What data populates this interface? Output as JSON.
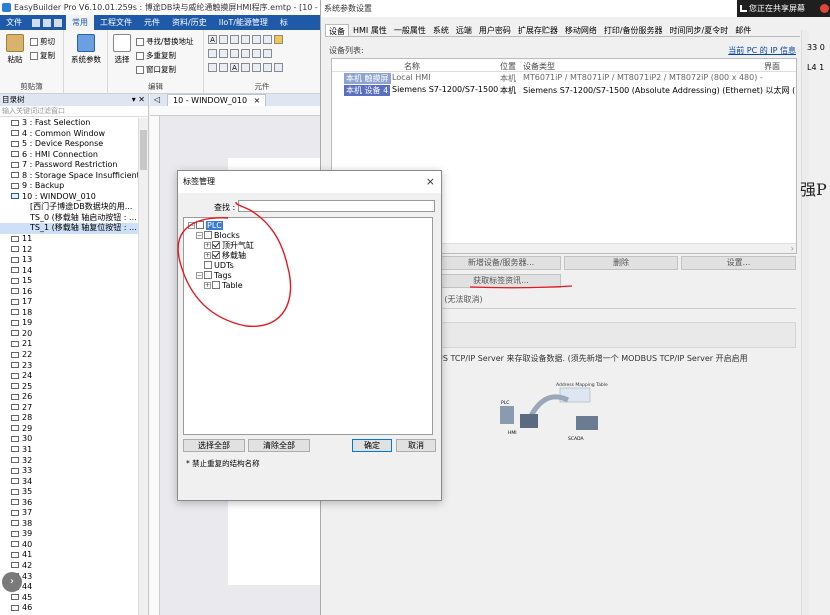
{
  "app": {
    "title": "EasyBuilder Pro V6.10.01.259s : 博途DB块与威纶通触摸屏HMI程序.emtp - [10 - WINDOW_010]",
    "menu": [
      "文件",
      "常用",
      "工程文件",
      "元件",
      "资料/历史",
      "IIoT/能源管理",
      "标"
    ],
    "active_menu": "常用",
    "ribbon": {
      "paste": "粘贴",
      "cut": "剪切",
      "copy": "复制",
      "clipboard_group": "剪贴簿",
      "sys_params": "系统参数",
      "select": "选择",
      "find_replace": "寻找/替换地址",
      "multi_copy": "多重复制",
      "window_copy": "窗口复制",
      "edit_group": "编辑",
      "element_group": "元件"
    },
    "tree": {
      "header": "目录树",
      "filter_placeholder": "输入关键词过滤窗口",
      "items": [
        {
          "label": "3 : Fast Selection",
          "kind": "page"
        },
        {
          "label": "4 : Common Window",
          "kind": "page"
        },
        {
          "label": "5 : Device Response",
          "kind": "page"
        },
        {
          "label": "6 : HMI Connection",
          "kind": "page"
        },
        {
          "label": "7 : Password Restriction",
          "kind": "page"
        },
        {
          "label": "8 : Storage Space Insufficient",
          "kind": "page"
        },
        {
          "label": "9 : Backup",
          "kind": "page"
        },
        {
          "label": "10 : WINDOW_010",
          "kind": "open"
        },
        {
          "label": "[西门子博途DB数据块的用...",
          "kind": "sub"
        },
        {
          "label": "TS_0 (移载轴 轴启动按钮 : ...",
          "kind": "sub"
        },
        {
          "label": "TS_1 (移载轴 轴复位按钮 : ...",
          "kind": "sub-sel"
        },
        {
          "label": "11",
          "kind": "page"
        },
        {
          "label": "12",
          "kind": "page"
        },
        {
          "label": "13",
          "kind": "page"
        },
        {
          "label": "14",
          "kind": "page"
        },
        {
          "label": "15",
          "kind": "page"
        },
        {
          "label": "16",
          "kind": "page"
        },
        {
          "label": "17",
          "kind": "page"
        },
        {
          "label": "18",
          "kind": "page"
        },
        {
          "label": "19",
          "kind": "page"
        },
        {
          "label": "20",
          "kind": "page"
        },
        {
          "label": "21",
          "kind": "page"
        },
        {
          "label": "22",
          "kind": "page"
        },
        {
          "label": "23",
          "kind": "page"
        },
        {
          "label": "24",
          "kind": "page"
        },
        {
          "label": "25",
          "kind": "page"
        },
        {
          "label": "26",
          "kind": "page"
        },
        {
          "label": "27",
          "kind": "page"
        },
        {
          "label": "28",
          "kind": "page"
        },
        {
          "label": "29",
          "kind": "page"
        },
        {
          "label": "30",
          "kind": "page"
        },
        {
          "label": "31",
          "kind": "page"
        },
        {
          "label": "32",
          "kind": "page"
        },
        {
          "label": "33",
          "kind": "page"
        },
        {
          "label": "34",
          "kind": "page"
        },
        {
          "label": "35",
          "kind": "page"
        },
        {
          "label": "36",
          "kind": "page"
        },
        {
          "label": "37",
          "kind": "page"
        },
        {
          "label": "38",
          "kind": "page"
        },
        {
          "label": "39",
          "kind": "page"
        },
        {
          "label": "40",
          "kind": "page"
        },
        {
          "label": "41",
          "kind": "page"
        },
        {
          "label": "42",
          "kind": "page"
        },
        {
          "label": "43",
          "kind": "page"
        },
        {
          "label": "44",
          "kind": "page"
        },
        {
          "label": "45",
          "kind": "page"
        },
        {
          "label": "46",
          "kind": "page"
        }
      ]
    },
    "editor_tab": "10 - WINDOW_010",
    "editor_tab_close": "×",
    "editor_nav": "◁"
  },
  "settings": {
    "title": "系统参数设置",
    "tabs": [
      "设备",
      "HMI 属性",
      "一般属性",
      "系统",
      "远端",
      "用户密码",
      "扩展存贮器",
      "移动网络",
      "打印/备份服务器",
      "时间同步/夏令时",
      "邮件"
    ],
    "active_tab": "设备",
    "device_list_label": "设备列表:",
    "current_pc_ip": "当前 PC 的 IP 信息",
    "columns": {
      "name": "名称",
      "location": "位置",
      "type": "设备类型",
      "interface": "界面"
    },
    "devices": [
      {
        "id": "本机 触摸屏",
        "name": "Local HMI",
        "location": "本机",
        "type": "MT6071iP / MT8071iP / MT8071iP2 / MT8072iP (800 x 480) -"
      },
      {
        "id": "本机 设备 4",
        "name": "Siemens S7-1200/S7-1500",
        "location": "本机",
        "type": "Siemens S7-1200/S7-1500 (Absolute Addressing) (Ethernet) 以太网 (I"
      }
    ],
    "buttons": {
      "new": "新增设备/服务器...",
      "delete": "删除",
      "settings": "设置...",
      "get_tags": "获取标签资讯..."
    },
    "no_cancel": "P (无法取消)",
    "modbus_text": "US TCP/IP Server 来存取设备数据. (须先新增一个 MODBUS TCP/IP Server 开启启用",
    "diagram": {
      "title": "Address Mapping Table",
      "plc": "PLC",
      "hmi": "HMI",
      "scada": "SCADA"
    },
    "big_char": "强P",
    "side_fields": [
      "33 0",
      "L4 1"
    ]
  },
  "share_bar": "您正在共享屏幕",
  "tag_manager": {
    "title": "标签管理",
    "close": "×",
    "search_label": "查找 :",
    "search_value": "",
    "tree": {
      "plc": "PLC",
      "blocks": "Blocks",
      "block_items": [
        "顶升气缸",
        "移载轴"
      ],
      "udts": "UDTs",
      "tags": "Tags",
      "table": "Table"
    },
    "buttons": {
      "select_all": "选择全部",
      "clear_all": "清除全部",
      "ok": "确定",
      "cancel": "取消"
    },
    "note": "* 禁止重复的结构名称"
  },
  "colors": {
    "accent": "#1e5aa8",
    "annotation": "#e8161e",
    "selection": "#3a7bd5"
  }
}
